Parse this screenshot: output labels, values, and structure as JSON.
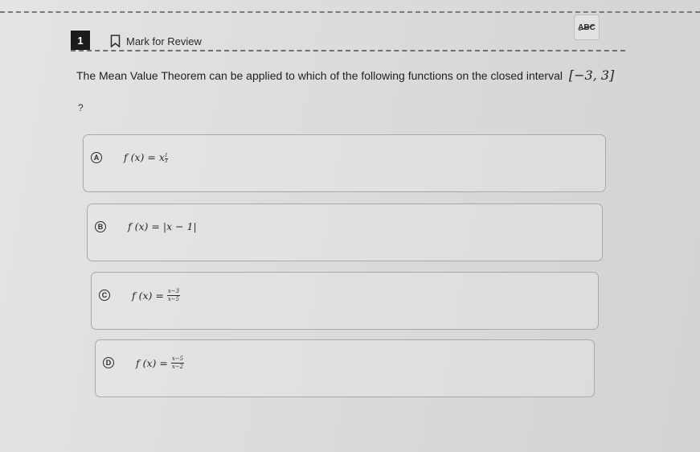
{
  "header": {
    "question_number": "1",
    "mark_review_label": "Mark for Review",
    "abc_tool_label": "ABC"
  },
  "question": {
    "text": "The Mean Value Theorem can be applied to which of the following functions on the closed interval",
    "interval": "[−3, 3]",
    "trailing": "?"
  },
  "choices": [
    {
      "letter": "A",
      "lhs": "f (x) = ",
      "base": "x",
      "exp_num": "1",
      "exp_den": "3"
    },
    {
      "letter": "B",
      "lhs": "f (x) = ",
      "expr": "|x − 1|"
    },
    {
      "letter": "C",
      "lhs": "f (x) = ",
      "num": "x−3",
      "den": "x−5"
    },
    {
      "letter": "D",
      "lhs": "f (x) = ",
      "num": "x−5",
      "den": "x−2"
    }
  ]
}
